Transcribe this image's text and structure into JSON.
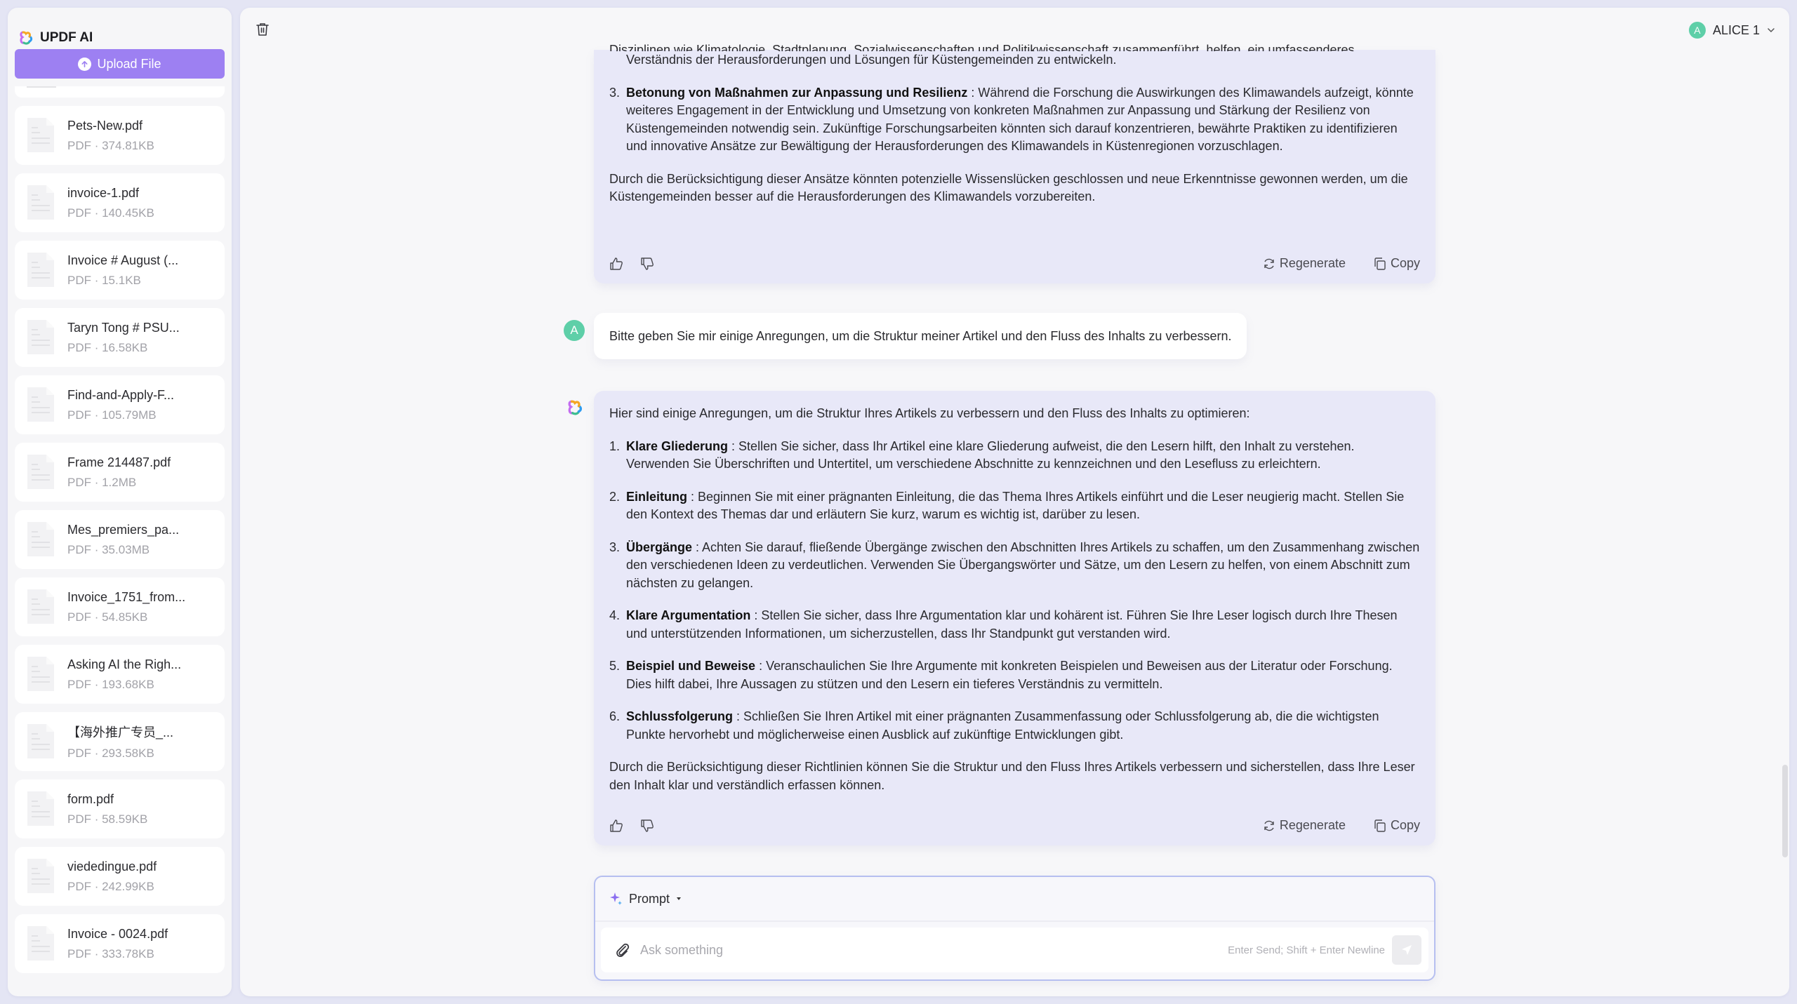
{
  "app": {
    "title": "UPDF AI",
    "upload_label": "Upload File"
  },
  "files": [
    {
      "name": "Pets-New.pdf",
      "meta": "PDF · 374.81KB"
    },
    {
      "name": "invoice-1.pdf",
      "meta": "PDF · 140.45KB"
    },
    {
      "name": "Invoice # August (...",
      "meta": "PDF · 15.1KB"
    },
    {
      "name": "Taryn Tong # PSU...",
      "meta": "PDF · 16.58KB"
    },
    {
      "name": "Find-and-Apply-F...",
      "meta": "PDF · 105.79MB"
    },
    {
      "name": "Frame 214487.pdf",
      "meta": "PDF · 1.2MB"
    },
    {
      "name": "Mes_premiers_pa...",
      "meta": "PDF · 35.03MB"
    },
    {
      "name": "Invoice_1751_from...",
      "meta": "PDF · 54.85KB"
    },
    {
      "name": "Asking AI the Righ...",
      "meta": "PDF · 193.68KB"
    },
    {
      "name": "【海外推广专员_...",
      "meta": "PDF · 293.58KB"
    },
    {
      "name": "form.pdf",
      "meta": "PDF · 58.59KB"
    },
    {
      "name": "viededingue.pdf",
      "meta": "PDF · 242.99KB"
    },
    {
      "name": "Invoice - 0024.pdf",
      "meta": "PDF · 333.78KB"
    }
  ],
  "header": {
    "user_initial": "A",
    "user_name": "ALICE 1"
  },
  "chat": {
    "first_answer": {
      "cut_line": "Disziplinen wie Klimatologie, Stadtplanung, Sozialwissenschaften und Politikwissenschaft zusammenführt, helfen, ein umfassenderes",
      "continued_line": "Verständnis der Herausforderungen und Lösungen für Küstengemeinden zu entwickeln.",
      "item3_num": "3.",
      "item3_title": "Betonung von Maßnahmen zur Anpassung und Resilienz",
      "item3_text": " : Während die Forschung die Auswirkungen des Klimawandels aufzeigt, könnte weiteres Engagement in der Entwicklung und Umsetzung von konkreten Maßnahmen zur Anpassung und Stärkung der Resilienz von Küstengemeinden notwendig sein. Zukünftige Forschungsarbeiten könnten sich darauf konzentrieren, bewährte Praktiken zu identifizieren und innovative Ansätze zur Bewältigung der Herausforderungen des Klimawandels in Küstenregionen vorzuschlagen.",
      "conclusion": "Durch die Berücksichtigung dieser Ansätze könnten potenzielle Wissenslücken geschlossen und neue Erkenntnisse gewonnen werden, um die Küstengemeinden besser auf die Herausforderungen des Klimawandels vorzubereiten."
    },
    "user_message": {
      "initial": "A",
      "text": "Bitte geben Sie mir einige Anregungen, um die Struktur meiner Artikel und den Fluss des Inhalts zu verbessern."
    },
    "second_answer": {
      "intro": "Hier sind einige Anregungen, um die Struktur Ihres Artikels zu verbessern und den Fluss des Inhalts zu optimieren:",
      "items": [
        {
          "num": "1.",
          "title": "Klare Gliederung",
          "text": " : Stellen Sie sicher, dass Ihr Artikel eine klare Gliederung aufweist, die den Lesern hilft, den Inhalt zu verstehen. Verwenden Sie Überschriften und Untertitel, um verschiedene Abschnitte zu kennzeichnen und den Lesefluss zu erleichtern."
        },
        {
          "num": "2.",
          "title": "Einleitung",
          "text": " : Beginnen Sie mit einer prägnanten Einleitung, die das Thema Ihres Artikels einführt und die Leser neugierig macht. Stellen Sie den Kontext des Themas dar und erläutern Sie kurz, warum es wichtig ist, darüber zu lesen."
        },
        {
          "num": "3.",
          "title": "Übergänge",
          "text": " : Achten Sie darauf, fließende Übergänge zwischen den Abschnitten Ihres Artikels zu schaffen, um den Zusammenhang zwischen den verschiedenen Ideen zu verdeutlichen. Verwenden Sie Übergangswörter und Sätze, um den Lesern zu helfen, von einem Abschnitt zum nächsten zu gelangen."
        },
        {
          "num": "4.",
          "title": "Klare Argumentation",
          "text": " : Stellen Sie sicher, dass Ihre Argumentation klar und kohärent ist. Führen Sie Ihre Leser logisch durch Ihre Thesen und unterstützenden Informationen, um sicherzustellen, dass Ihr Standpunkt gut verstanden wird."
        },
        {
          "num": "5.",
          "title": "Beispiel und Beweise",
          "text": " : Veranschaulichen Sie Ihre Argumente mit konkreten Beispielen und Beweisen aus der Literatur oder Forschung. Dies hilft dabei, Ihre Aussagen zu stützen und den Lesern ein tieferes Verständnis zu vermitteln."
        },
        {
          "num": "6.",
          "title": "Schlussfolgerung",
          "text": " : Schließen Sie Ihren Artikel mit einer prägnanten Zusammenfassung oder Schlussfolgerung ab, die die wichtigsten Punkte hervorhebt und möglicherweise einen Ausblick auf zukünftige Entwicklungen gibt."
        }
      ],
      "conclusion": "Durch die Berücksichtigung dieser Richtlinien können Sie die Struktur und den Fluss Ihres Artikels verbessern und sicherstellen, dass Ihre Leser den Inhalt klar und verständlich erfassen können."
    },
    "actions": {
      "regenerate": "Regenerate",
      "copy": "Copy"
    }
  },
  "prompt": {
    "mode_label": "Prompt",
    "placeholder": "Ask something",
    "hint": "Enter Send; Shift + Enter Newline"
  },
  "colors": {
    "accent": "#9d80f2",
    "ai_bubble": "#e8e8f8",
    "avatar": "#5ecfa8",
    "page_bg": "#e4e5f4"
  }
}
